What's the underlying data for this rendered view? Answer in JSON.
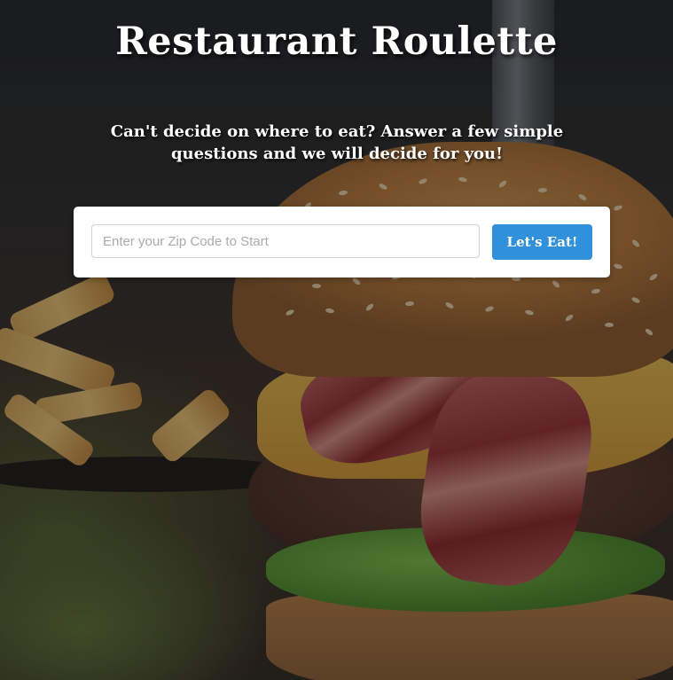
{
  "page": {
    "title": "Restaurant Roulette",
    "subtitle": "Can't decide on where to eat? Answer a few simple questions and we will decide for you!"
  },
  "search": {
    "placeholder": "Enter your Zip Code to Start",
    "value": "",
    "button_label": "Let's Eat!"
  },
  "theme": {
    "accent": "#3190dc",
    "card": "#ffffff",
    "title_color": "#ffffff"
  },
  "background": {
    "icon": "burger-photo"
  }
}
